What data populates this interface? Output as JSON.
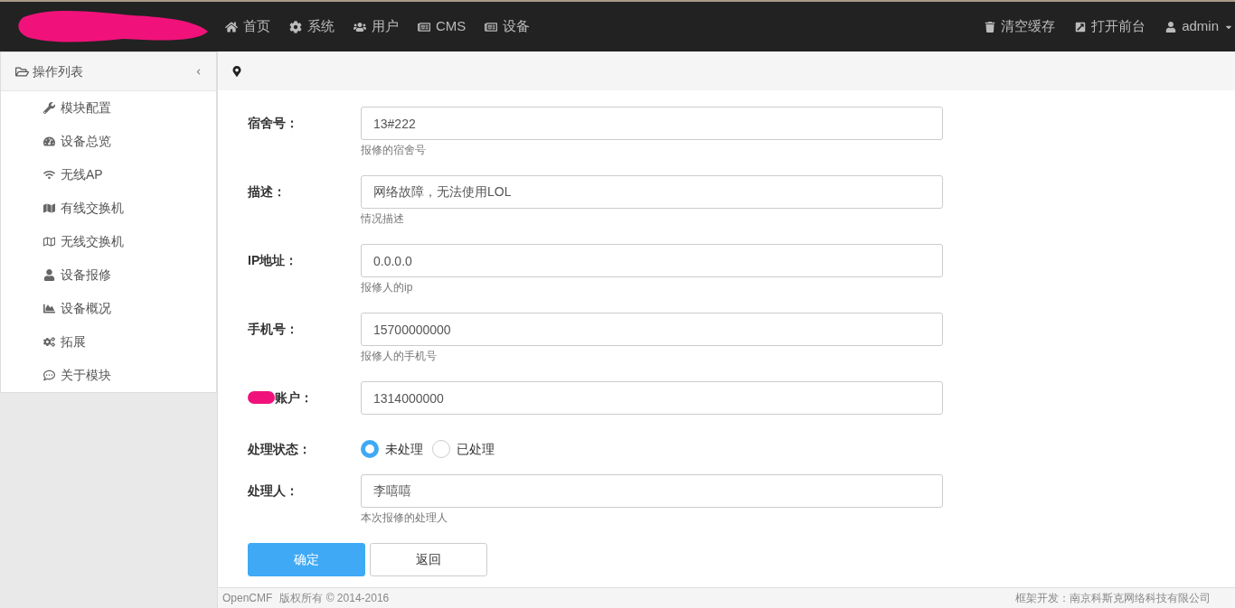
{
  "navbar": {
    "menu": [
      {
        "label": "首页"
      },
      {
        "label": "系统"
      },
      {
        "label": "用户"
      },
      {
        "label": "CMS"
      },
      {
        "label": "设备"
      }
    ],
    "actions": [
      {
        "label": "清空缓存"
      },
      {
        "label": "打开前台"
      },
      {
        "label": "admin"
      }
    ]
  },
  "sidebar": {
    "title": "操作列表",
    "items": [
      {
        "label": "模块配置"
      },
      {
        "label": "设备总览"
      },
      {
        "label": "无线AP"
      },
      {
        "label": "有线交换机"
      },
      {
        "label": "无线交换机"
      },
      {
        "label": "设备报修"
      },
      {
        "label": "设备概况"
      },
      {
        "label": "拓展"
      },
      {
        "label": "关于模块"
      }
    ]
  },
  "form": {
    "fields": [
      {
        "kind": "text",
        "label": "宿舍号：",
        "value": "13#222",
        "help": "报修的宿舍号"
      },
      {
        "kind": "text",
        "label": "描述：",
        "value": "网络故障，无法使用LOL",
        "help": "情况描述"
      },
      {
        "kind": "text",
        "label": "IP地址：",
        "value": "0.0.0.0",
        "help": "报修人的ip"
      },
      {
        "kind": "text",
        "label": "手机号：",
        "value": "15700000000",
        "help": "报修人的手机号"
      },
      {
        "kind": "text",
        "label": "账户：",
        "value": "1314000000",
        "redacted": true
      },
      {
        "kind": "radio",
        "label": "处理状态：",
        "options": [
          {
            "label": "未处理",
            "selected": true
          },
          {
            "label": "已处理",
            "selected": false
          }
        ]
      },
      {
        "kind": "text",
        "label": "处理人：",
        "value": "李嘻嘻",
        "help": "本次报修的处理人"
      }
    ],
    "buttons": [
      {
        "label": "确定",
        "kind": "primary"
      },
      {
        "label": "返回",
        "kind": "default"
      }
    ]
  },
  "footer": {
    "brand": "OpenCMF",
    "copyright": "版权所有 © 2014-2016",
    "credit": "框架开发：南京科斯克网络科技有限公司"
  }
}
